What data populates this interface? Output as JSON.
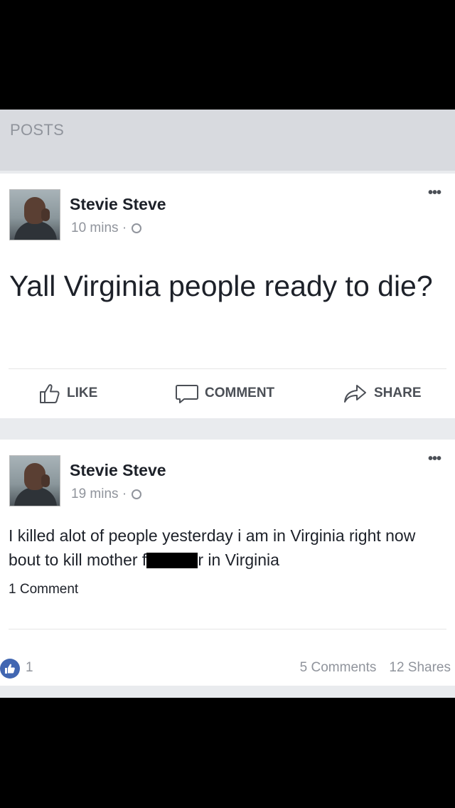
{
  "section": {
    "title": "POSTS"
  },
  "post1": {
    "author": "Stevie Steve",
    "time": "10 mins",
    "separator": "·",
    "more": "•••",
    "text": "Yall Virginia people ready to die?"
  },
  "actions": {
    "like": "LIKE",
    "comment": "COMMENT",
    "share": "SHARE"
  },
  "post2": {
    "author": "Stevie Steve",
    "time": "19 mins",
    "separator": "·",
    "more": "•••",
    "text_part1": "I killed alot of people yesterday i am in Virginia right now bout to kill mother f",
    "text_part2": "r in Virginia",
    "comment_count": "1 Comment",
    "reaction_count": "1",
    "comments": "5 Comments",
    "shares": "12 Shares"
  },
  "colors": {
    "facebook_blue": "#4267b2",
    "text": "#1d2129",
    "muted": "#90949c"
  },
  "icons": [
    "thumbs-up-icon",
    "comment-bubble-icon",
    "share-arrow-icon",
    "globe-icon",
    "more-options-icon"
  ]
}
